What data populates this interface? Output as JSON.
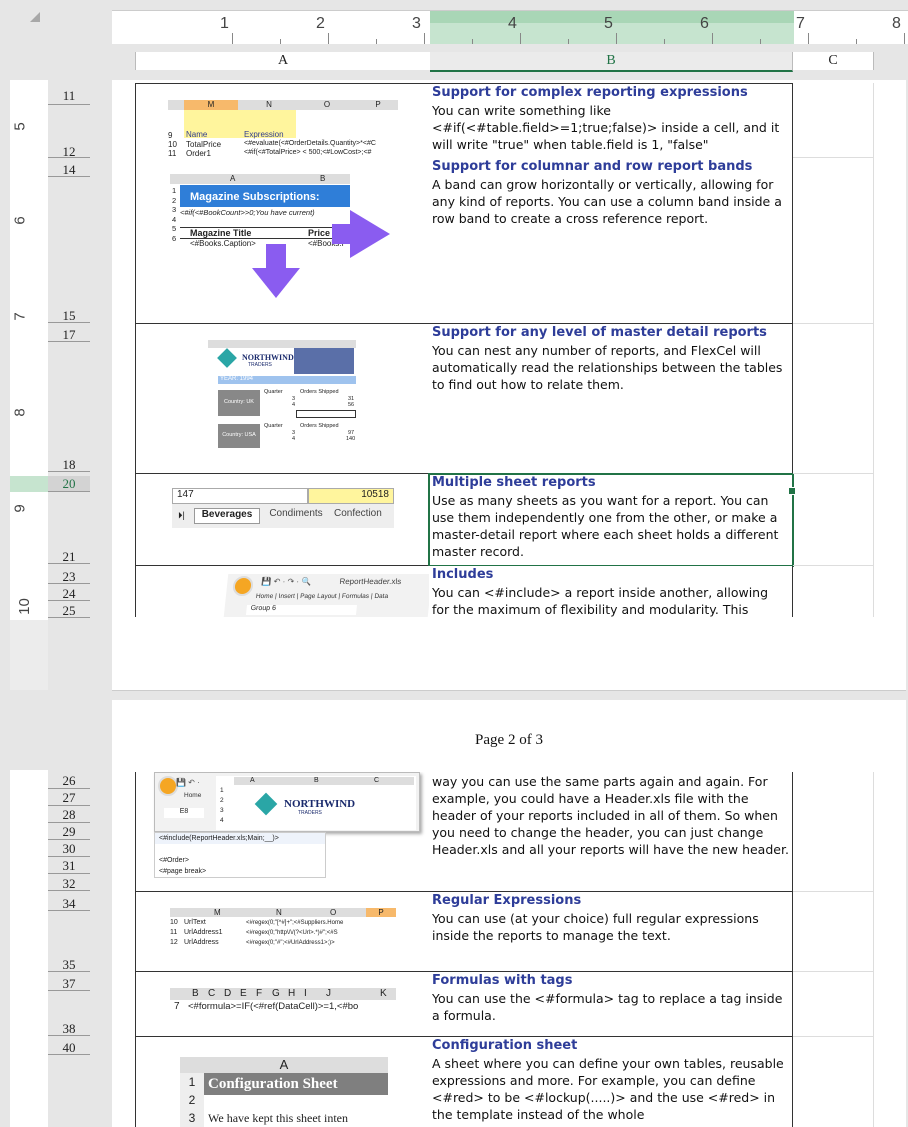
{
  "ruler": {
    "top_numbers": [
      "1",
      "2",
      "3",
      "4",
      "5",
      "6",
      "7",
      "8"
    ],
    "left_numbers": [
      "5",
      "6",
      "7",
      "8",
      "9",
      "10"
    ]
  },
  "columns": [
    "A",
    "B",
    "C"
  ],
  "page_label": "Page 2 of 3",
  "rows_page1": [
    "11",
    "12",
    "14",
    "15",
    "17",
    "18",
    "20",
    "21",
    "23",
    "24",
    "25"
  ],
  "rows_page2": [
    "26",
    "27",
    "28",
    "29",
    "30",
    "31",
    "32",
    "34",
    "35",
    "37",
    "38",
    "40"
  ],
  "features": [
    {
      "title": "Support for complex reporting expressions",
      "desc": "You can write something like <#if(<#table.field>=1;true;false)> inside a cell, and it will write \"true\" when table.field is 1, \"false\""
    },
    {
      "title": "Support for columnar and row report bands",
      "desc": "A band can grow horizontally or vertically, allowing for any kind of reports. You can use a column band inside a row band to create a cross reference report."
    },
    {
      "title": "Support for any level of master detail reports",
      "desc": "You can nest any number of reports, and FlexCel will automatically read the relationships between the tables to find out how to relate them."
    },
    {
      "title": "Multiple sheet reports",
      "desc": "Use as many sheets as you want for a report. You can use them independently one from the other, or make a master-detail report where each sheet holds a different master record."
    },
    {
      "title": "Includes",
      "desc": "You can <#include> a report inside another, allowing for the maximum of flexibility and modularity. This"
    },
    {
      "title": "",
      "desc": "way you can use the same parts again and again. For example, you could have a Header.xls file with the header of your reports included in all of them. So when you need to change the header, you can just change Header.xls and all your reports will have the new header."
    },
    {
      "title": "Regular Expressions",
      "desc": "You can use (at your choice) full regular expressions inside the reports to manage the text."
    },
    {
      "title": "Formulas with tags",
      "desc": "You can use the <#formula> tag to replace a tag inside a formula."
    },
    {
      "title": "Configuration sheet",
      "desc": "A sheet where you can define your own tables, reusable expressions and more. For example, you can define <#red> to be <#lockup(.....)> and the use <#red> in the template instead of the whole"
    }
  ],
  "thumbs": {
    "t1": {
      "cols": [
        "M",
        "N",
        "O",
        "P"
      ],
      "rows": [
        "9",
        "10",
        "11"
      ],
      "c1": [
        "Name",
        "TotalPrice",
        "Order1"
      ],
      "c2": [
        "Expression",
        "<#evaluate(<#OrderDetails.Quantity>*<#C",
        "<#if(<#TotalPrice> < 500;<#LowCost>;<#"
      ]
    },
    "t2": {
      "cols": [
        "A",
        "B"
      ],
      "title": "Magazine Subscriptions:",
      "r2": "<#if(<#BookCount>>0;You have current)",
      "h1": "Magazine Title",
      "h2": "Price",
      "r5a": "<#Books.Caption>",
      "r5b": "<#Books.F",
      "rows": [
        "1",
        "2",
        "3",
        "4",
        "5",
        "6"
      ]
    },
    "t3": {
      "logo": "NORTHWIND",
      "logo_sub": "TRADERS",
      "year": "YEAR: 1994",
      "q": "Quarter",
      "os": "Orders Shipped",
      "uk": "Country: UK",
      "usa": "Country: USA",
      "v": [
        "3",
        "4",
        "31",
        "56",
        "3",
        "4",
        "97",
        "140"
      ]
    },
    "t4": {
      "tabs": [
        "Beverages",
        "Condiments",
        "Confection"
      ],
      "v1": "147",
      "v2": "10518"
    },
    "t5": {
      "title": "ReportHeader.xls",
      "menu": [
        "Home",
        "Insert",
        "Page Layout",
        "Formulas",
        "Data"
      ],
      "group": "Group 6"
    },
    "t6": {
      "menu": "Home",
      "cell": "E8",
      "cols": [
        "A",
        "B",
        "C"
      ],
      "rows": [
        "1",
        "2",
        "3",
        "4"
      ],
      "logo": "NORTHWIND",
      "logo_sub": "TRADERS",
      "include": "<#include(ReportHeader.xls;Main;__)>",
      "order": "<#Order>",
      "pb": "<#page break>"
    },
    "t7": {
      "cols": [
        "M",
        "N",
        "O",
        "P"
      ],
      "rows": [
        "10",
        "11",
        "12"
      ],
      "names": [
        "UrlText",
        "UrlAddress1",
        "UrlAddress"
      ],
      "exprs": [
        "<#regex(0;\"[^#]+\";<#Suppliers.Home",
        "<#regex(0;\"http\\/\\/(?<Url>.*)#\";<#S",
        "<#regex(0;\"#\";<#UrlAddress1>;)>"
      ]
    },
    "t8": {
      "cols": [
        "B",
        "C",
        "D",
        "E",
        "F",
        "G",
        "H",
        "I",
        "J",
        "K"
      ],
      "row": "7",
      "formula": "<#formula>=IF(<#ref(DataCell)>=1,<#bo"
    },
    "t9": {
      "col": "A",
      "rows": [
        "1",
        "2",
        "3"
      ],
      "title": "Configuration Sheet",
      "r3": "We have kept this sheet inten"
    }
  },
  "colors": {
    "title": "#2e3d99",
    "selection": "#217346",
    "arrow": "#8a5cf0",
    "blue": "#2f7ed8",
    "yellow": "#fff59d"
  }
}
